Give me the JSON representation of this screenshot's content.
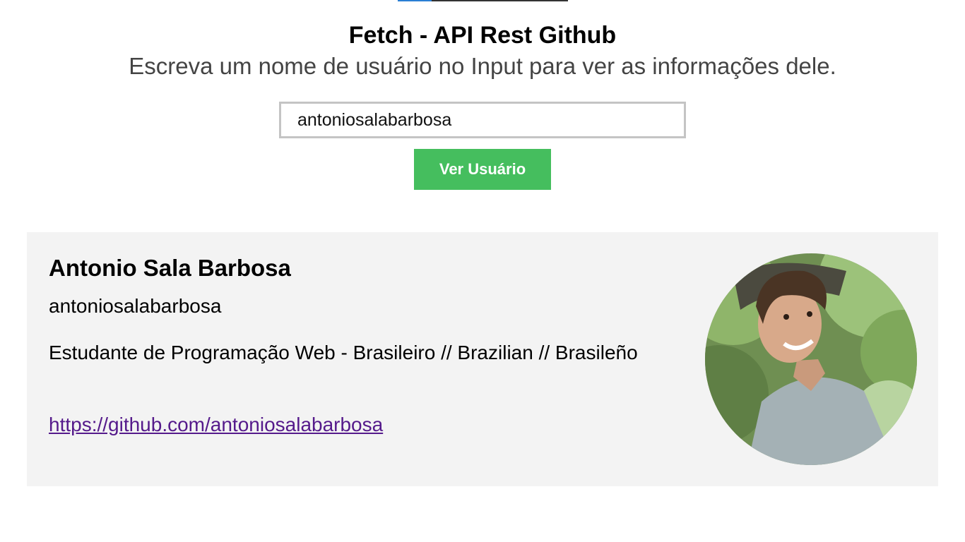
{
  "header": {
    "title": "Fetch - API Rest Github",
    "subtitle": "Escreva um nome de usuário no Input para ver as informações dele."
  },
  "search": {
    "value": "antoniosalabarbosa",
    "button_label": "Ver Usuário"
  },
  "profile": {
    "name": "Antonio Sala Barbosa",
    "login": "antoniosalabarbosa",
    "bio": "Estudante de Programação Web - Brasileiro // Brazilian // Brasileño",
    "url": "https://github.com/antoniosalabarbosa",
    "avatar_icon": "user-photo"
  },
  "colors": {
    "button": "#45be5e",
    "card_background": "#f3f3f3",
    "link": "#551a8b"
  }
}
